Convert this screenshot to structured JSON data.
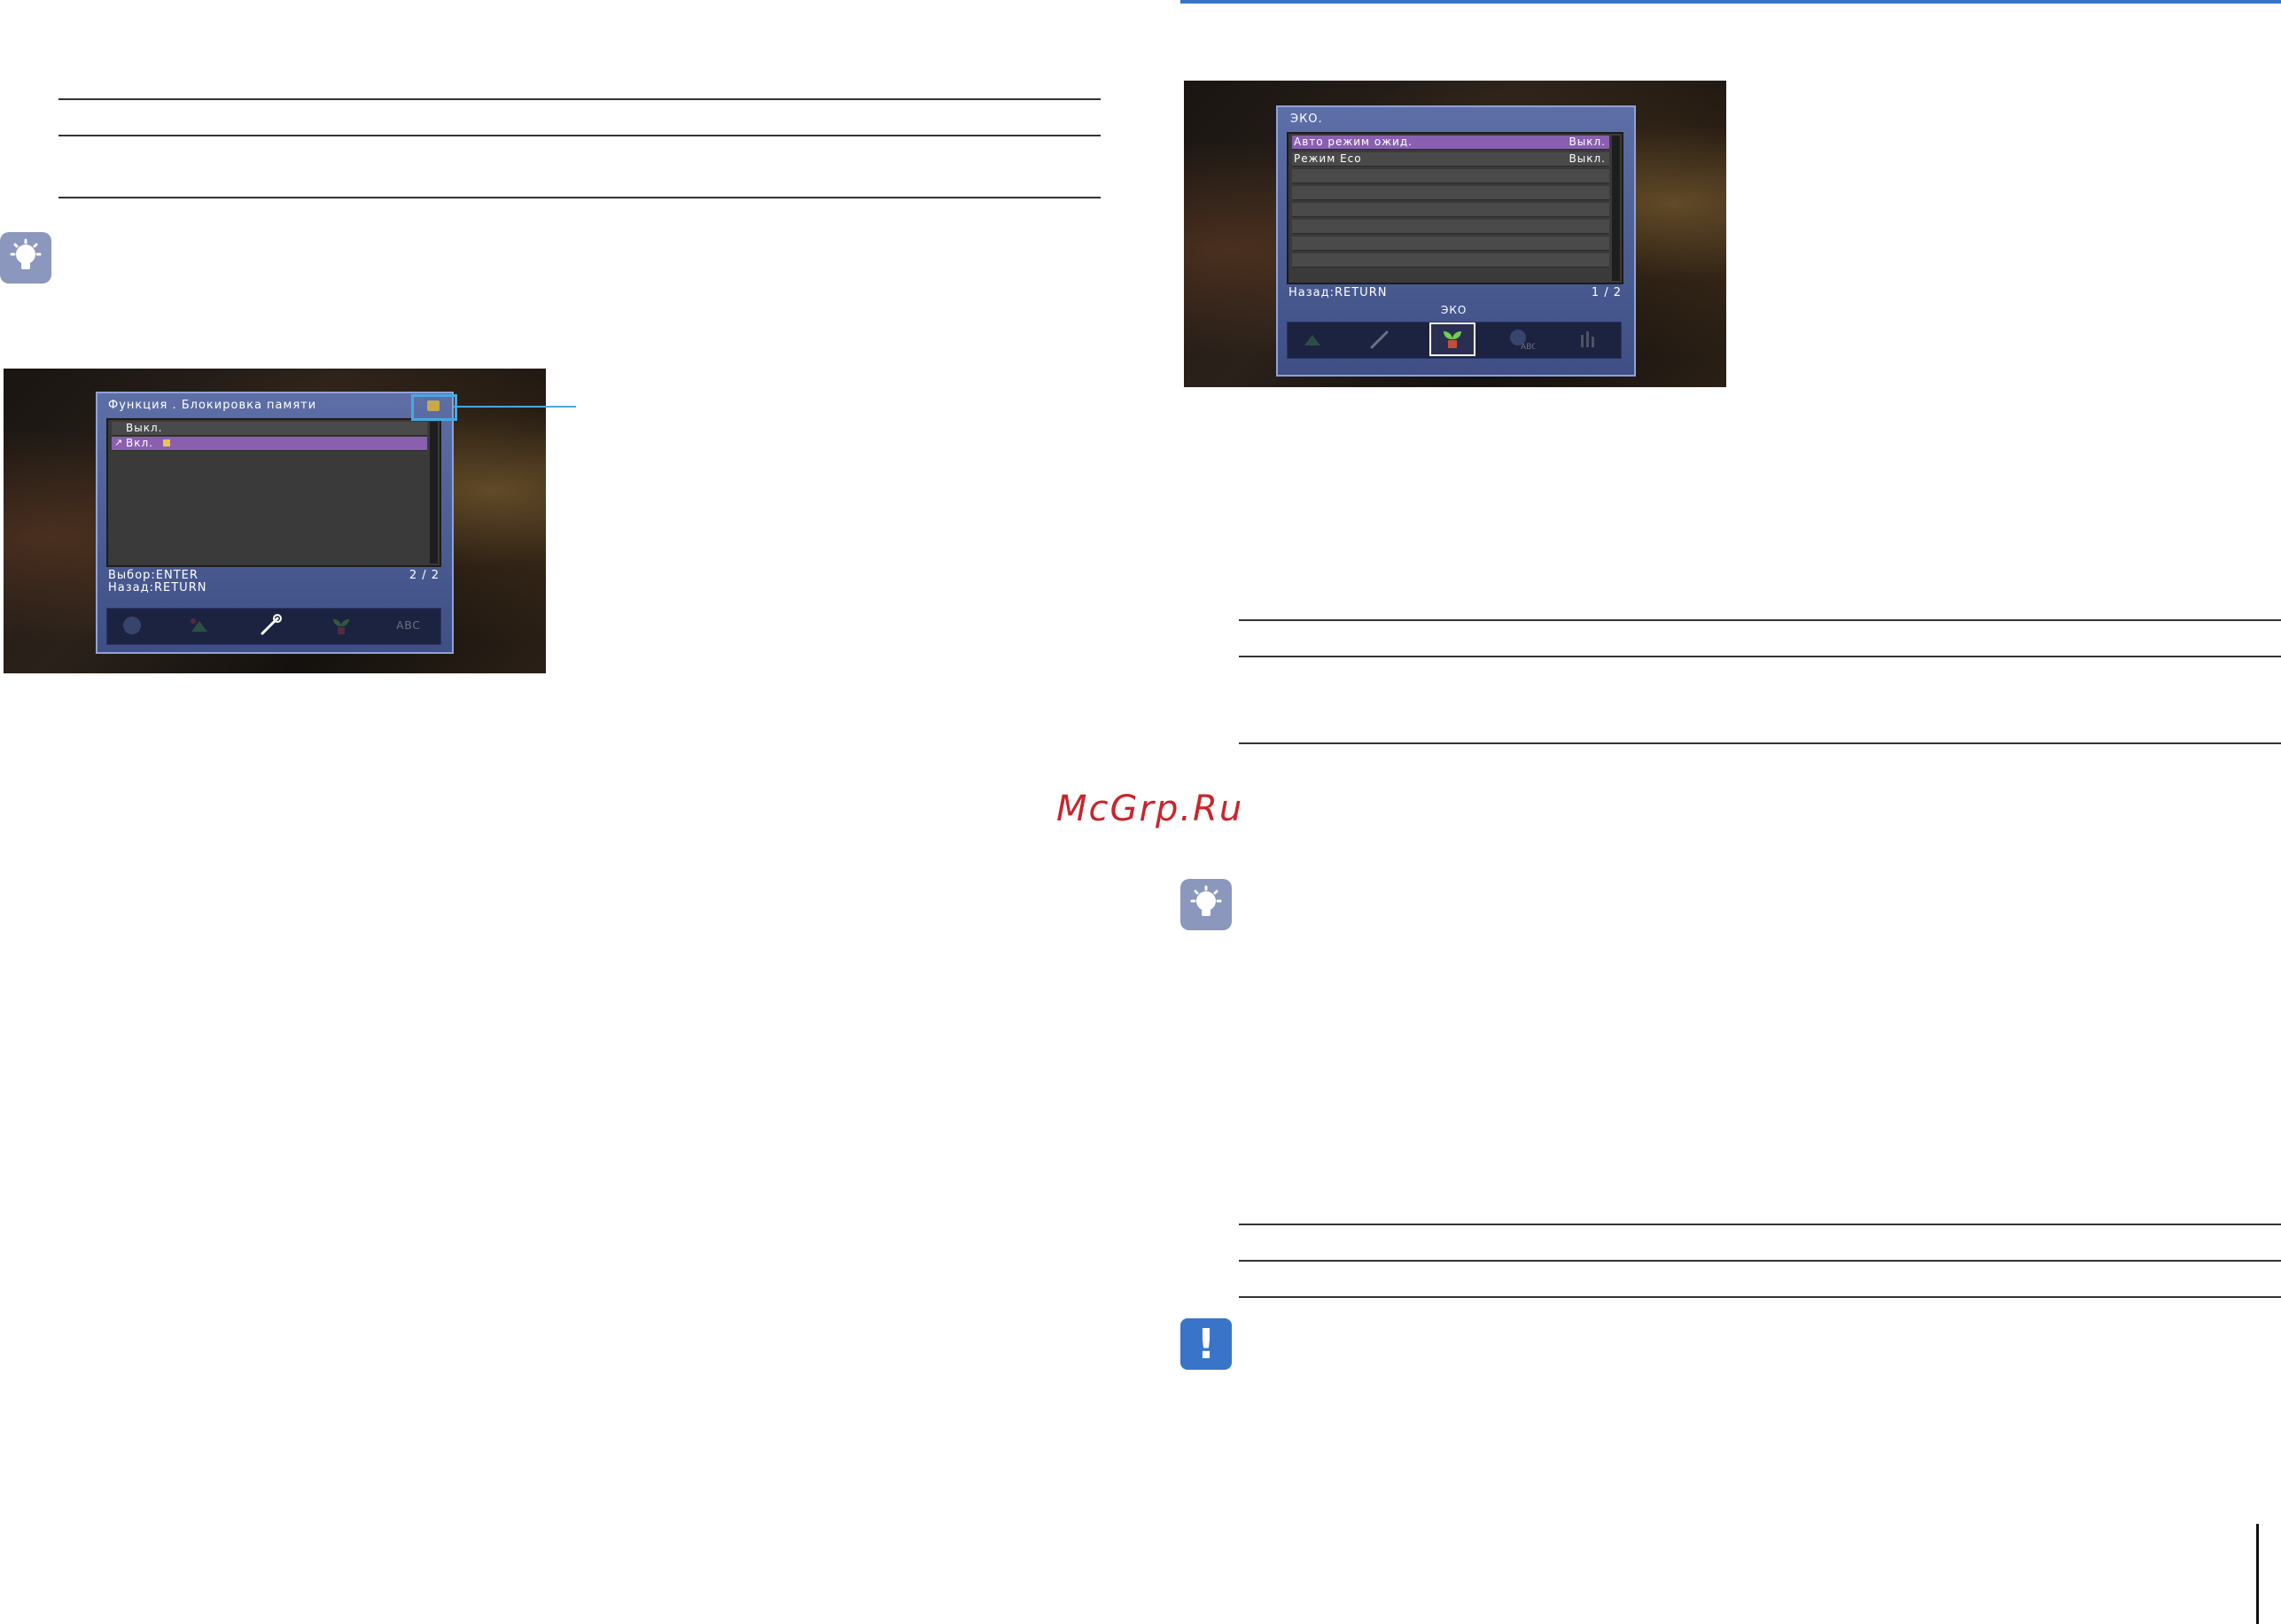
{
  "left_screen": {
    "title": "Функция . Блокировка памяти",
    "options": [
      "Выкл.",
      "Вкл."
    ],
    "footer_select": "Выбор:ENTER",
    "footer_back": "Назад:RETURN",
    "page_indicator": "2 / 2",
    "bar_icons": [
      "globe-abc-icon",
      "plant-arrows-icon",
      "wrench-icon",
      "eco-plant-icon",
      "abc-icon"
    ]
  },
  "right_screen": {
    "title": "ЭКО.",
    "rows": [
      {
        "label": "Авто режим ожид.",
        "value": "Выкл."
      },
      {
        "label": "Режим Eco",
        "value": "Выкл."
      }
    ],
    "footer_back": "Назад:RETURN",
    "page_indicator": "1 / 2",
    "bar_caption": "ЭКО",
    "bar_icons": [
      "plant-arrows-icon",
      "wrench-icon",
      "eco-plant-icon",
      "globe-abc-icon",
      "bars-icon"
    ]
  },
  "watermark": "McGrp.Ru",
  "colors": {
    "accent_blue": "#3a74c8",
    "callout": "#4aa8e0",
    "highlight": "#8a5fb0",
    "watermark": "#c8262c"
  }
}
